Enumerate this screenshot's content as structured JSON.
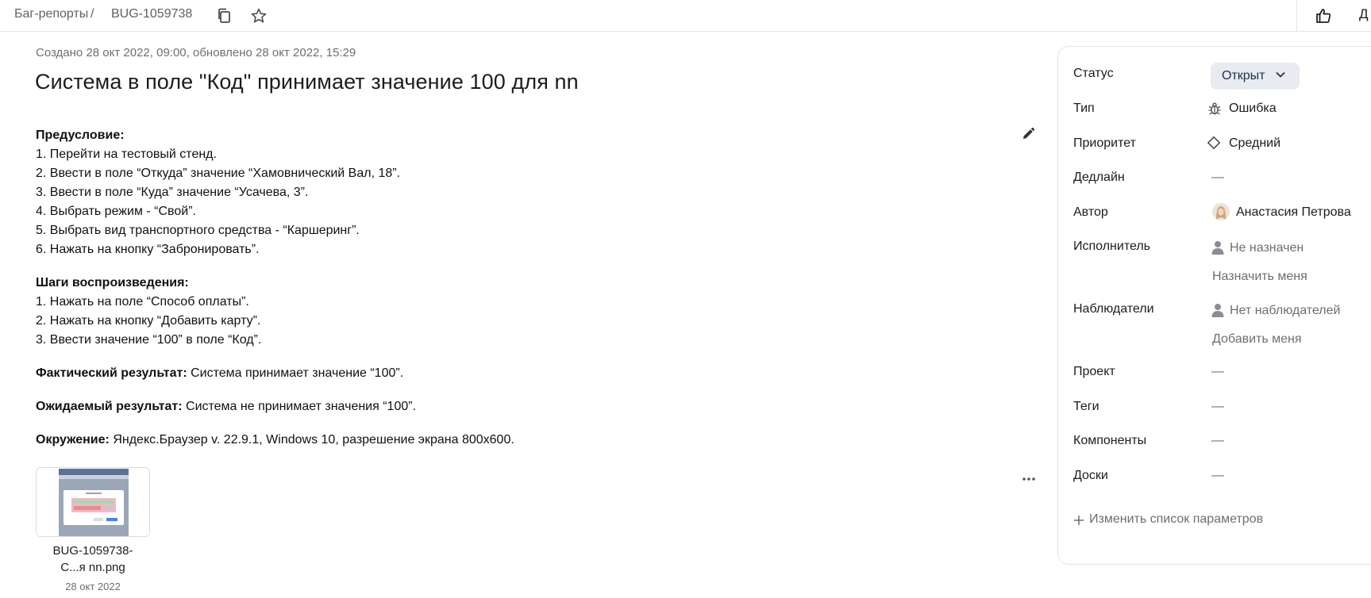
{
  "breadcrumb": {
    "section": "Баг-репорты",
    "separator": "/",
    "issue_key": "BUG-1059738"
  },
  "topbar": {
    "cutoff_label": "Д"
  },
  "issue": {
    "meta": "Создано 28 окт 2022, 09:00, обновлено 28 окт 2022, 15:29",
    "title": "Система в поле \"Код\" принимает значение 100 для nn"
  },
  "description": {
    "precondition_heading": "Предусловие:",
    "precondition_steps": [
      "1. Перейти на тестовый стенд.",
      "2. Ввести в поле “Откуда” значение “Хамовнический Вал, 18”.",
      "3. Ввести в поле “Куда” значение “Усачева, 3”.",
      "4. Выбрать режим - “Свой”.",
      "5. Выбрать вид транспортного средства - “Каршеринг”.",
      "6. Нажать на кнопку “Забронировать”."
    ],
    "steps_heading": "Шаги воспроизведения:",
    "steps": [
      "1. Нажать на поле “Способ оплаты”.",
      "2. Нажать на кнопку “Добавить карту”.",
      "3. Ввести значение “100” в поле “Код”."
    ],
    "actual_label": "Фактический результат:",
    "actual_text": " Система принимает значение “100”.",
    "expected_label": "Ожидаемый результат:",
    "expected_text": " Система не принимает значения “100”.",
    "env_label": "Окружение:",
    "env_text": " Яндекс.Браузер v. 22.9.1, Windows 10, разрешение экрана 800x600."
  },
  "attachment": {
    "name_line1": "BUG-1059738-",
    "name_line2": "С...я nn.png",
    "date": "28 окт 2022"
  },
  "sidebar": {
    "status_label": "Статус",
    "status_value": "Открыт",
    "type_label": "Тип",
    "type_value": "Ошибка",
    "priority_label": "Приоритет",
    "priority_value": "Средний",
    "deadline_label": "Дедлайн",
    "deadline_value": "—",
    "author_label": "Автор",
    "author_value": "Анастасия Петрова",
    "assignee_label": "Исполнитель",
    "assignee_value": "Не назначен",
    "assign_me": "Назначить меня",
    "watchers_label": "Наблюдатели",
    "watchers_value": "Нет наблюдателей",
    "add_me": "Добавить меня",
    "project_label": "Проект",
    "project_value": "—",
    "tags_label": "Теги",
    "tags_value": "—",
    "components_label": "Компоненты",
    "components_value": "—",
    "boards_label": "Доски",
    "boards_value": "—",
    "change_params": "Изменить список параметров"
  }
}
